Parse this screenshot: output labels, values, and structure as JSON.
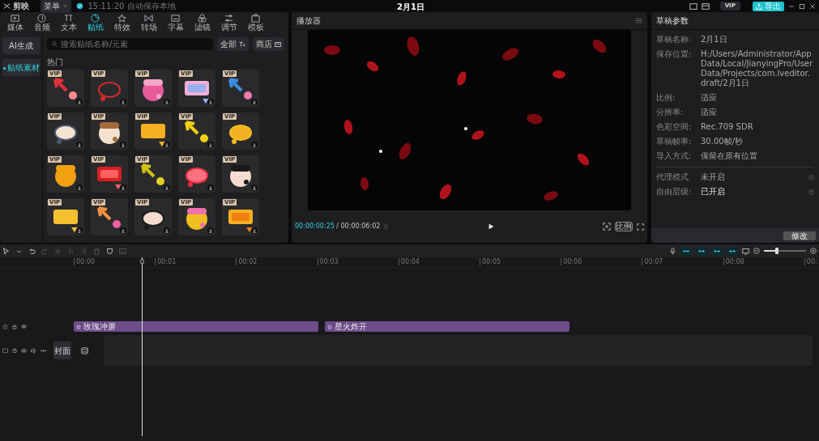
{
  "app": {
    "name": "剪映",
    "menu": "菜单",
    "save_status": "15:11:20 自动保存本地",
    "title": "2月1日",
    "vip": "VIP",
    "export": "导出"
  },
  "media_tabs": [
    {
      "label": "媒体",
      "selected": false
    },
    {
      "label": "音频",
      "selected": false
    },
    {
      "label": "文本",
      "selected": false
    },
    {
      "label": "贴纸",
      "selected": true
    },
    {
      "label": "特效",
      "selected": false
    },
    {
      "label": "转场",
      "selected": false
    },
    {
      "label": "字幕",
      "selected": false
    },
    {
      "label": "滤镜",
      "selected": false
    },
    {
      "label": "调节",
      "selected": false
    },
    {
      "label": "模板",
      "selected": false
    }
  ],
  "sticker_sidebar": [
    {
      "label": "AI生成",
      "selected": false
    },
    {
      "label": "贴纸素材",
      "selected": true
    }
  ],
  "search": {
    "placeholder": "搜索贴纸名称/元素"
  },
  "filters": [
    "全部",
    "商店"
  ],
  "section_title": "热门",
  "stickers": [
    {
      "badge": "VIP"
    },
    {
      "badge": "VIP"
    },
    {
      "badge": "VIP"
    },
    {
      "badge": "VIP"
    },
    {
      "badge": "VIP"
    },
    {
      "badge": "VIP"
    },
    {
      "badge": "VIP"
    },
    {
      "badge": "VIP"
    },
    {
      "badge": "VIP"
    },
    {
      "badge": "VIP"
    },
    {
      "badge": "VIP"
    },
    {
      "badge": "VIP"
    },
    {
      "badge": "VIP"
    },
    {
      "badge": "VIP"
    },
    {
      "badge": "VIP"
    },
    {
      "badge": "VIP"
    },
    {
      "badge": "VIP"
    },
    {
      "badge": "VIP"
    },
    {
      "badge": "VIP"
    },
    {
      "badge": "VIP"
    }
  ],
  "player": {
    "title": "播放器",
    "current_time": "00:00:00:25",
    "separator": "/",
    "duration": "00:00:06:02",
    "ratio": "比例"
  },
  "draft_panel": {
    "title": "草稿参数",
    "params": [
      {
        "label": "草稿名称:",
        "value": "2月1日"
      },
      {
        "label": "保存位置:",
        "value": "H:/Users/Administrator/AppData/Local/JianyingPro/User Data/Projects/com.lveditor.draft/2月1日"
      },
      {
        "label": "比例:",
        "value": "适应"
      },
      {
        "label": "分辨率:",
        "value": "适应"
      },
      {
        "label": "色彩空间:",
        "value": "Rec.709 SDR"
      },
      {
        "label": "草稿帧率:",
        "value": "30.00帧/秒"
      },
      {
        "label": "导入方式:",
        "value": "保留在原有位置"
      }
    ],
    "toggles": [
      {
        "label": "代理模式",
        "value": "未开启",
        "on": false
      },
      {
        "label": "自由层级:",
        "value": "已开启",
        "on": true
      }
    ],
    "button": "修改"
  },
  "timeline": {
    "ruler": [
      "00:00",
      "00:01",
      "00:02",
      "00:03",
      "00:04",
      "00:05",
      "00:06",
      "00:07",
      "00:08",
      "00:"
    ],
    "zoom": {
      "level": 0.3
    },
    "sticker_clips": [
      {
        "label": "玫瑰冲屏"
      },
      {
        "label": "星火炸开"
      }
    ],
    "cover": "封面"
  }
}
